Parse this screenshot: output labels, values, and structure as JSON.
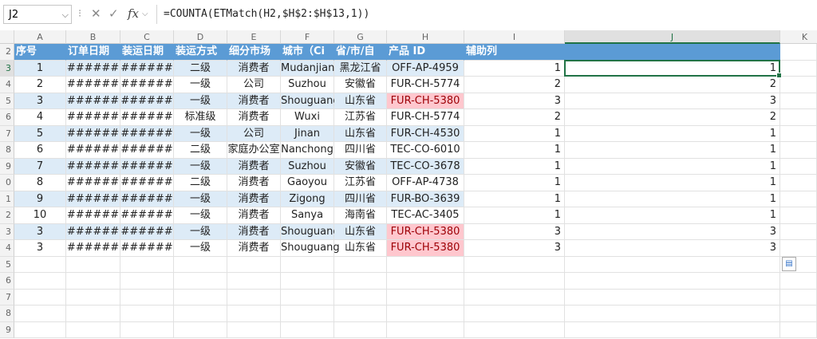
{
  "formula_bar": {
    "name_box": "J2",
    "formula": "=COUNTA(ETMatch(H2,$H$2:$H$13,1))"
  },
  "columns": [
    "A",
    "B",
    "C",
    "D",
    "E",
    "F",
    "G",
    "H",
    "I",
    "J",
    "K"
  ],
  "row_numbers": [
    "2",
    "2",
    "3",
    "4",
    "5",
    "6",
    "7",
    "8",
    "9",
    "0",
    "1",
    "2",
    "3",
    "4",
    "5",
    "6",
    "7",
    "8",
    "9"
  ],
  "header": [
    "序号",
    "订单日期",
    "装运日期",
    "装运方式",
    "细分市场",
    "城市（Ci",
    "省/市/自",
    "产品 ID",
    "辅助列"
  ],
  "rows": [
    {
      "a": "1",
      "b": "######",
      "c": "######",
      "d": "二级",
      "e": "消费者",
      "f": "Mudanjiang",
      "g": "黑龙江省",
      "h": "OFF-AP-4959",
      "i": "1",
      "j": "1"
    },
    {
      "a": "2",
      "b": "######",
      "c": "######",
      "d": "一级",
      "e": "公司",
      "f": "Suzhou",
      "g": "安徽省",
      "h": "FUR-CH-5774",
      "i": "2",
      "j": "2"
    },
    {
      "a": "3",
      "b": "######",
      "c": "######",
      "d": "一级",
      "e": "消费者",
      "f": "Shouguang",
      "g": "山东省",
      "h": "FUR-CH-5380",
      "i": "3",
      "j": "3"
    },
    {
      "a": "4",
      "b": "######",
      "c": "######",
      "d": "标准级",
      "e": "消费者",
      "f": "Wuxi",
      "g": "江苏省",
      "h": "FUR-CH-5774",
      "i": "2",
      "j": "2"
    },
    {
      "a": "5",
      "b": "######",
      "c": "######",
      "d": "一级",
      "e": "公司",
      "f": "Jinan",
      "g": "山东省",
      "h": "FUR-CH-4530",
      "i": "1",
      "j": "1"
    },
    {
      "a": "6",
      "b": "######",
      "c": "######",
      "d": "二级",
      "e": "家庭办公室",
      "f": "Nanchong",
      "g": "四川省",
      "h": "TEC-CO-6010",
      "i": "1",
      "j": "1"
    },
    {
      "a": "7",
      "b": "######",
      "c": "######",
      "d": "一级",
      "e": "消费者",
      "f": "Suzhou",
      "g": "安徽省",
      "h": "TEC-CO-3678",
      "i": "1",
      "j": "1"
    },
    {
      "a": "8",
      "b": "######",
      "c": "######",
      "d": "二级",
      "e": "消费者",
      "f": "Gaoyou",
      "g": "江苏省",
      "h": "OFF-AP-4738",
      "i": "1",
      "j": "1"
    },
    {
      "a": "9",
      "b": "######",
      "c": "######",
      "d": "一级",
      "e": "消费者",
      "f": "Zigong",
      "g": "四川省",
      "h": "FUR-BO-3639",
      "i": "1",
      "j": "1"
    },
    {
      "a": "10",
      "b": "######",
      "c": "######",
      "d": "一级",
      "e": "消费者",
      "f": "Sanya",
      "g": "海南省",
      "h": "TEC-AC-3405",
      "i": "1",
      "j": "1"
    },
    {
      "a": "3",
      "b": "######",
      "c": "######",
      "d": "一级",
      "e": "消费者",
      "f": "Shouguang",
      "g": "山东省",
      "h": "FUR-CH-5380",
      "i": "3",
      "j": "3"
    },
    {
      "a": "3",
      "b": "######",
      "c": "######",
      "d": "一级",
      "e": "消费者",
      "f": "Shouguang",
      "g": "山东省",
      "h": "FUR-CH-5380",
      "i": "3",
      "j": "3"
    }
  ],
  "colors": {
    "header_fill": "#5b9bd5",
    "band_fill": "#ddebf7",
    "duplicate_fill": "#ffc7ce",
    "selection": "#217346"
  },
  "icons": {
    "paste_options": "paste-options-icon"
  }
}
